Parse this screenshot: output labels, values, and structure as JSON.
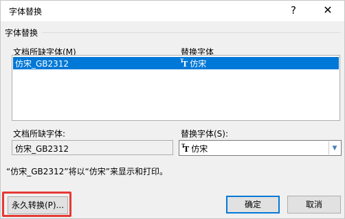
{
  "window": {
    "title": "字体替换",
    "help_glyph": "?",
    "close_glyph": "✕"
  },
  "group": {
    "label": "字体替换"
  },
  "columns": {
    "missing_header": "文档所缺字体(M)",
    "substitute_header": "替换字体"
  },
  "list": {
    "rows": [
      {
        "missing": "仿宋_GB2312",
        "substitute": "仿宋",
        "selected": true
      }
    ]
  },
  "fields": {
    "missing_label": "文档所缺字体:",
    "missing_value": "仿宋_GB2312",
    "substitute_label": "替换字体(S):",
    "substitute_value": "仿宋"
  },
  "info": {
    "text": "“仿宋_GB2312”将以“仿宋”来显示和打印。"
  },
  "buttons": {
    "convert": "永久转换(P)...",
    "ok": "确定",
    "cancel": "取消"
  },
  "colors": {
    "selection": "#0078d7",
    "highlight_border": "#e53935"
  },
  "icons": {
    "font_icon": "truetype-font-icon",
    "dropdown_icon": "chevron-down-icon"
  }
}
